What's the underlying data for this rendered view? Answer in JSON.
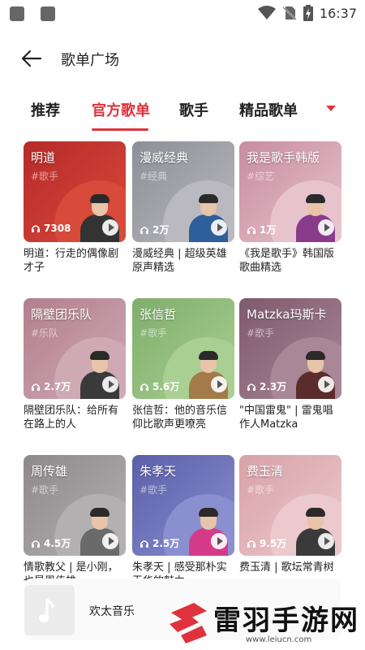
{
  "status": {
    "time": "16:37"
  },
  "header": {
    "title": "歌单广场"
  },
  "tabs": [
    {
      "label": "推荐",
      "active": false
    },
    {
      "label": "官方歌单",
      "active": true
    },
    {
      "label": "歌手",
      "active": false
    },
    {
      "label": "精品歌单",
      "active": false
    }
  ],
  "cards": [
    {
      "title": "明道",
      "tag": "#歌手",
      "plays": "7308",
      "desc": "明道：行走的偶像剧才子",
      "bg": "#b62a2a",
      "circle": "#d84a3a",
      "body_color": "#333333"
    },
    {
      "title": "漫威经典",
      "tag": "#经典",
      "plays": "2万",
      "desc": "漫威经典 | 超级英雄原声精选",
      "bg": "#8e8e96",
      "circle": "#b9b9bf",
      "body_color": "#2f5f9a"
    },
    {
      "title": "我是歌手韩版",
      "tag": "#综艺",
      "plays": "1万",
      "desc": "《我是歌手》韩国版歌曲精选",
      "bg": "#c78ca0",
      "circle": "#e7c4cd",
      "body_color": "#8a3c8c"
    },
    {
      "title": "隔壁团乐队",
      "tag": "#乐队",
      "plays": "2.7万",
      "desc": "隔壁团乐队：给所有在路上的人",
      "bg": "#b27f8e",
      "circle": "#cfa9b3",
      "body_color": "#3a3a3a"
    },
    {
      "title": "张信哲",
      "tag": "#歌手",
      "plays": "5.6万",
      "desc": "张信哲：他的音乐信仰比歌声更嘹亮",
      "bg": "#7fae6c",
      "circle": "#a9cf92",
      "body_color": "#a37a4a"
    },
    {
      "title": "Matzka玛斯卡",
      "tag": "#歌手",
      "plays": "2.3万",
      "desc": "\"中国雷鬼\" | 雷鬼唱作人Matzka",
      "bg": "#7e5a6c",
      "circle": "#a98797",
      "body_color": "#5a2c2c"
    },
    {
      "title": "周传雄",
      "tag": "#歌手",
      "plays": "4.5万",
      "desc": "情歌教父 | 是小刚，也是周传雄",
      "bg": "#8e8a8c",
      "circle": "#b3b0b2",
      "body_color": "#6a6a6a"
    },
    {
      "title": "朱孝天",
      "tag": "#歌手",
      "plays": "2.5万",
      "desc": "朱孝天 | 感受那朴实无华的魅力",
      "bg": "#5a5fa8",
      "circle": "#8a8fd0",
      "body_color": "#d33a8a"
    },
    {
      "title": "费玉清",
      "tag": "#歌手",
      "plays": "9.5万",
      "desc": "费玉清 | 歌坛常青树",
      "bg": "#d7a2a8",
      "circle": "#ecc9cc",
      "body_color": "#3a3a3a"
    }
  ],
  "player": {
    "title": "欢太音乐"
  },
  "watermark": {
    "name": "雷羽手游网",
    "url": "www.leiucn.com"
  },
  "icons": {
    "back": "arrow-left-icon",
    "plays": "headphones-icon",
    "play": "play-icon",
    "more": "triangle-down-icon",
    "music": "music-note-icon"
  },
  "colors": {
    "accent": "#e0323c"
  }
}
